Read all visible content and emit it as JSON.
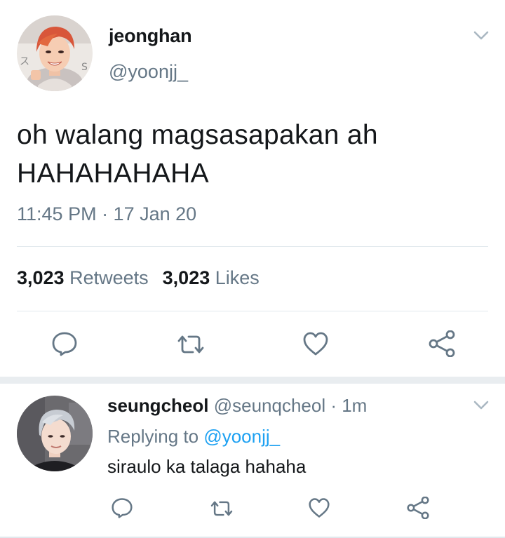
{
  "tweet": {
    "author_name": "jeonghan",
    "author_handle": "@yoonjj_",
    "text_line1": "oh walang magsasapakan ah",
    "text_line2": "HAHAHAHAHA",
    "timestamp": "11:45 PM · 17 Jan 20",
    "retweets_count": "3,023",
    "retweets_label": "Retweets",
    "likes_count": "3,023",
    "likes_label": "Likes",
    "actions": [
      "reply-icon",
      "retweet-icon",
      "like-icon",
      "share-icon"
    ]
  },
  "reply": {
    "author_name": "seungcheol",
    "author_handle": "@seunqcheol",
    "separator": " · ",
    "time": "1m",
    "replying_prefix": "Replying to ",
    "replying_mention": "@yoonjj_",
    "text": "siraulo ka talaga hahaha",
    "actions": [
      "reply-icon",
      "retweet-icon",
      "like-icon",
      "share-icon"
    ]
  },
  "colors": {
    "primary_text": "#14171a",
    "secondary_text": "#657786",
    "link": "#1da1f2",
    "divider": "#e1e8ed"
  }
}
